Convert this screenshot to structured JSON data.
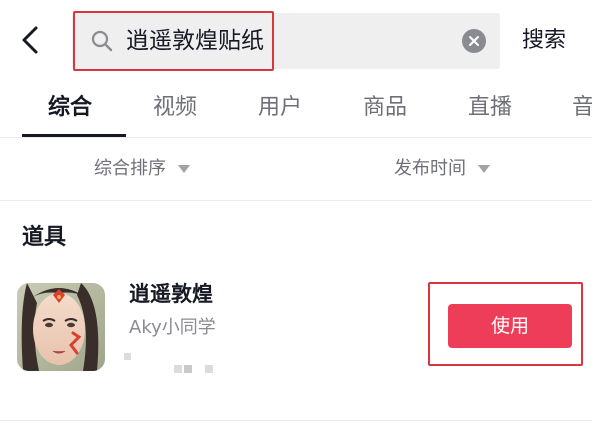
{
  "search": {
    "query": "逍遥敦煌贴纸",
    "submit_label": "搜索"
  },
  "tabs": [
    {
      "label": "综合",
      "active": true
    },
    {
      "label": "视频",
      "active": false
    },
    {
      "label": "用户",
      "active": false
    },
    {
      "label": "商品",
      "active": false
    },
    {
      "label": "直播",
      "active": false
    },
    {
      "label": "音",
      "active": false
    }
  ],
  "filters": {
    "sort_label": "综合排序",
    "time_label": "发布时间"
  },
  "section": {
    "title": "道具"
  },
  "result": {
    "title": "逍遥敦煌",
    "author": "Aky小同学",
    "use_label": "使用"
  },
  "icons": {
    "back": "chevron-left-icon",
    "search": "search-icon",
    "clear": "clear-icon",
    "caret": "caret-down-icon"
  },
  "colors": {
    "accent": "#ee3d58",
    "highlight_box": "#d9363e",
    "text_primary": "#161823",
    "text_secondary": "#6f7077"
  }
}
